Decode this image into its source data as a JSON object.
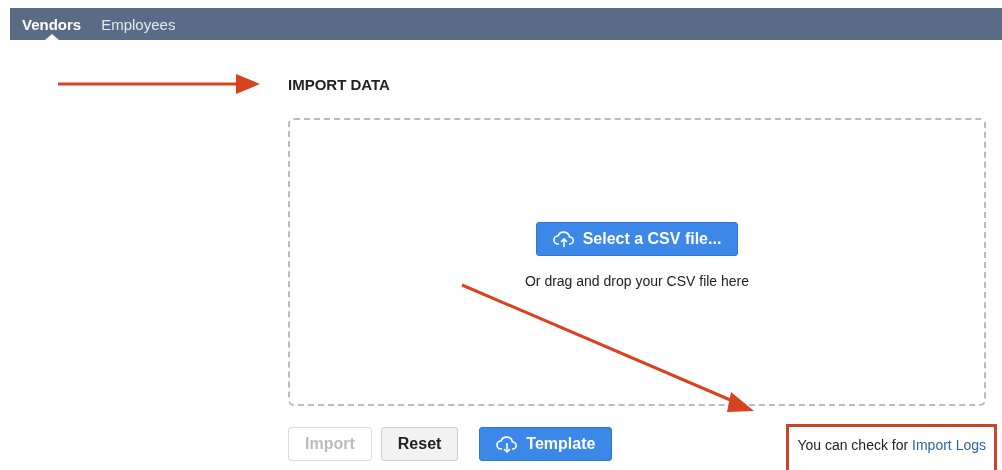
{
  "tabs": [
    {
      "label": "Vendors",
      "selected": true
    },
    {
      "label": "Employees",
      "selected": false
    }
  ],
  "heading": "IMPORT DATA",
  "dropzone": {
    "button": "Select a CSV file...",
    "hint": "Or drag and drop your CSV file here"
  },
  "buttons": [
    {
      "label": "Import",
      "kind": "plain",
      "disabled": true
    },
    {
      "label": "Reset",
      "kind": "plain",
      "disabled": false
    },
    {
      "label": "Template",
      "kind": "primary",
      "disabled": false
    }
  ],
  "note": {
    "text": "You can check for ",
    "link": "Import Logs"
  }
}
